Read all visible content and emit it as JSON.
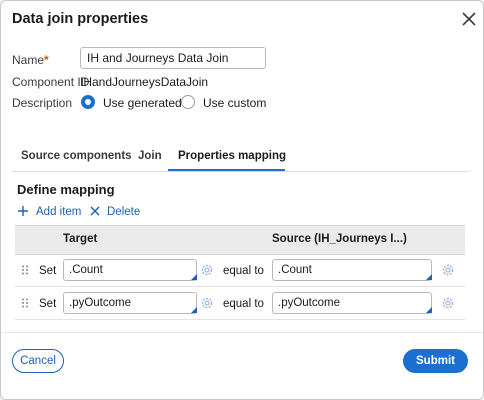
{
  "dialog": {
    "title": "Data join properties",
    "close_icon": "close-icon"
  },
  "form": {
    "name_label": "Name",
    "required_mark": "*",
    "name_value": "IH and Journeys Data Join",
    "component_id_label": "Component ID",
    "component_id_value": "IHandJourneysDataJoin",
    "description_label": "Description",
    "description_options": [
      {
        "label": "Use generated",
        "selected": true
      },
      {
        "label": "Use custom",
        "selected": false
      }
    ]
  },
  "tabs": [
    {
      "label": "Source components",
      "active": false
    },
    {
      "label": "Join",
      "active": false
    },
    {
      "label": "Properties mapping",
      "active": true
    }
  ],
  "mapping": {
    "section_title": "Define mapping",
    "add_label": "Add item",
    "delete_label": "Delete",
    "columns": {
      "target": "Target",
      "source": "Source (IH_Journeys I...)"
    },
    "rows": [
      {
        "set": "Set",
        "target": ".Count",
        "operator": "equal to",
        "source": ".Count"
      },
      {
        "set": "Set",
        "target": ".pyOutcome",
        "operator": "equal to",
        "source": ".pyOutcome"
      }
    ]
  },
  "footer": {
    "cancel_label": "Cancel",
    "submit_label": "Submit"
  },
  "colors": {
    "accent": "#1b6fd1",
    "link": "#1b5fb8",
    "required": "#d35400"
  }
}
